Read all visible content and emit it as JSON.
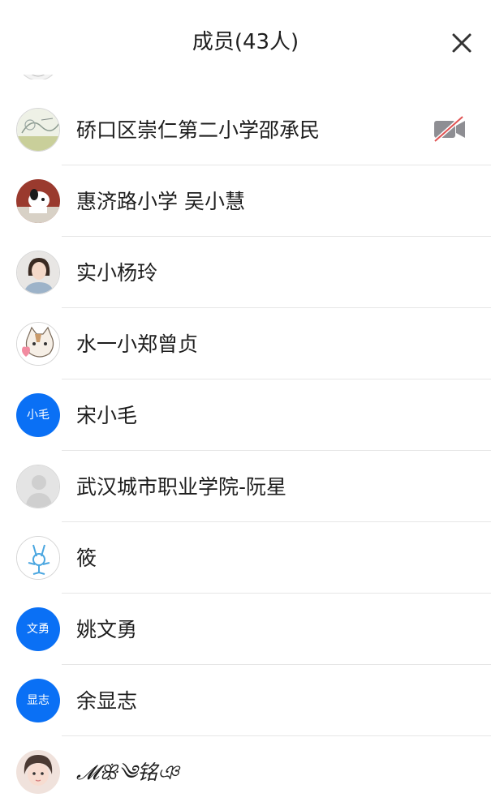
{
  "header": {
    "title": "成员(43人)",
    "close_icon": "close-icon"
  },
  "members": [
    {
      "name": "硚口区崇仁第二小学邵承民",
      "avatar": "photo-sketch",
      "camera_off": true
    },
    {
      "name": "惠济路小学 吴小慧",
      "avatar": "photo-snoopy",
      "camera_off": false
    },
    {
      "name": "实小杨玲",
      "avatar": "photo-woman",
      "camera_off": false
    },
    {
      "name": "水一小郑曾贞",
      "avatar": "photo-cartoon-cat",
      "camera_off": false
    },
    {
      "name": "宋小毛",
      "avatar_text": "小毛",
      "camera_off": false
    },
    {
      "name": "武汉城市职业学院-阮星",
      "avatar": "default-user-icon",
      "camera_off": false
    },
    {
      "name": "筱",
      "avatar": "photo-doodle",
      "camera_off": false
    },
    {
      "name": "姚文勇",
      "avatar_text": "文勇",
      "camera_off": false
    },
    {
      "name": "余显志",
      "avatar_text": "显志",
      "camera_off": false
    },
    {
      "name": "𝓜ꕥ༄铭ঞ",
      "avatar": "photo-child",
      "camera_off": false
    }
  ],
  "colors": {
    "accent": "#0a70f5",
    "divider": "#e6e6e6",
    "camera_off_slash": "#e05252"
  }
}
